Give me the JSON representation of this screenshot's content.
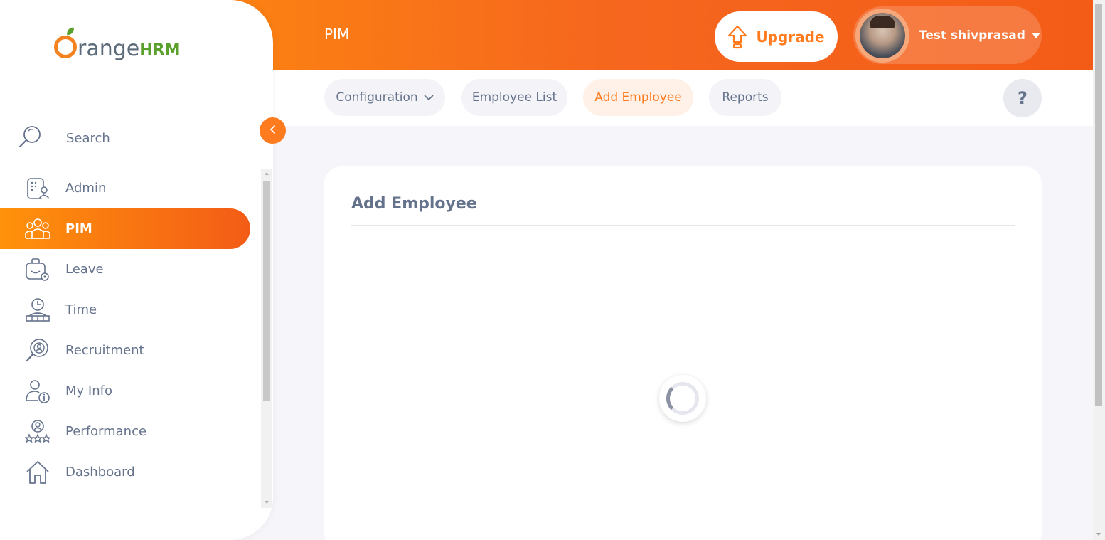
{
  "header": {
    "module_title": "PIM",
    "upgrade_label": "Upgrade",
    "user_name": "Test shivprasad",
    "accent_color": "#f6671e"
  },
  "subnav": {
    "tabs": [
      {
        "label": "Configuration",
        "has_dropdown": true,
        "active": false
      },
      {
        "label": "Employee List",
        "active": false
      },
      {
        "label": "Add Employee",
        "active": true
      },
      {
        "label": "Reports",
        "active": false
      }
    ],
    "help_label": "?"
  },
  "sidebar": {
    "logo_text": "range",
    "logo_suffix": "HRM",
    "search_label": "Search",
    "items": [
      {
        "label": "Admin",
        "icon": "admin-icon",
        "active": false
      },
      {
        "label": "PIM",
        "icon": "pim-icon",
        "active": true
      },
      {
        "label": "Leave",
        "icon": "leave-icon",
        "active": false
      },
      {
        "label": "Time",
        "icon": "time-icon",
        "active": false
      },
      {
        "label": "Recruitment",
        "icon": "recruitment-icon",
        "active": false
      },
      {
        "label": "My Info",
        "icon": "my-info-icon",
        "active": false
      },
      {
        "label": "Performance",
        "icon": "performance-icon",
        "active": false
      },
      {
        "label": "Dashboard",
        "icon": "dashboard-icon",
        "active": false
      }
    ]
  },
  "main": {
    "card_title": "Add Employee",
    "loading": true
  }
}
